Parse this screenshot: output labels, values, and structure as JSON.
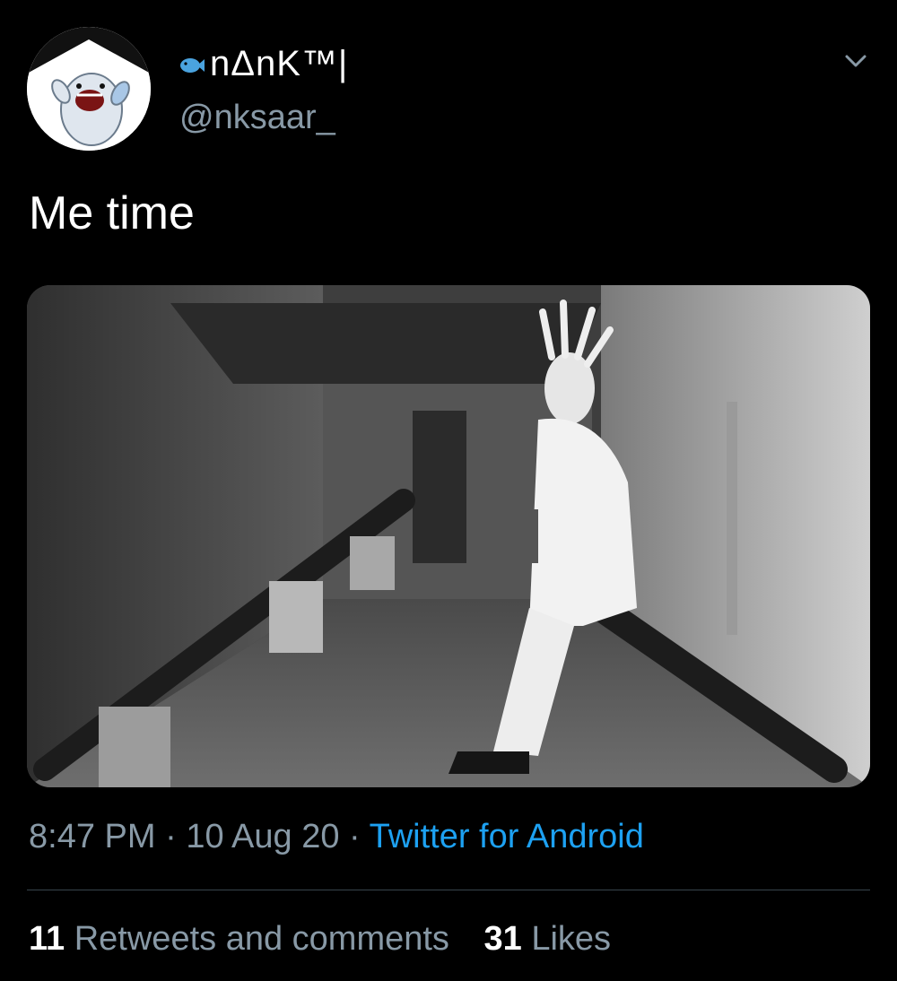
{
  "author": {
    "display_name": "nΔnK™|",
    "handle": "@nksaar_",
    "avatar_icon": "shark-mascot-avatar",
    "name_icon": "fish-icon"
  },
  "tweet": {
    "text": "Me time",
    "media_description_icon": "grayscale-photo",
    "time": "8:47 PM",
    "separator": "·",
    "date": "10 Aug 20",
    "source": "Twitter for Android"
  },
  "stats": {
    "retweets_count": "11",
    "retweets_label": "Retweets and comments",
    "likes_count": "31",
    "likes_label": "Likes"
  },
  "colors": {
    "background": "#000000",
    "secondary_text": "#8899a6",
    "link": "#1da1f2",
    "divider": "#38444d"
  }
}
